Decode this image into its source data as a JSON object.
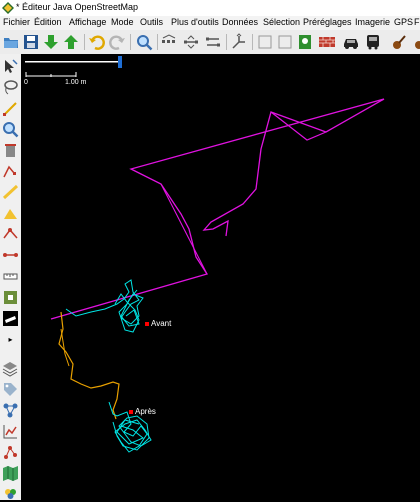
{
  "window": {
    "title": "* Éditeur Java OpenStreetMap"
  },
  "menu": [
    "Fichier",
    "Édition",
    "Affichage",
    "Mode",
    "Outils",
    "Plus d'outils",
    "Données",
    "Sélection",
    "Préréglages",
    "Imagerie",
    "GPS",
    "F"
  ],
  "map": {
    "scale_start": "0",
    "scale_end": "1.00 m",
    "markers": [
      {
        "label": "Avant"
      },
      {
        "label": "Après"
      }
    ]
  },
  "colors": {
    "way": "#e012e0",
    "gps_track": "#00e5e5",
    "old_track": "#e8a000",
    "marker": "#ff0000"
  },
  "icons": {
    "toolbar": [
      "open-folder-icon",
      "save-icon",
      "download-icon",
      "upload-icon",
      "undo-icon",
      "redo-icon",
      "zoom-icon",
      "select-nodes-icon",
      "align-icon",
      "move-icon",
      "split-icon",
      "preferences-icon",
      "wall-icon",
      "car-icon",
      "bus-icon",
      "guitar-icon"
    ],
    "left": [
      "select-tool-icon",
      "lasso-icon",
      "draw-tool-icon",
      "zoom-tool-icon",
      "delete-tool-icon",
      "parallel-tool-icon",
      "improve-way-icon",
      "extrude-icon",
      "draw-node-icon",
      "connect-icon",
      "measure-icon",
      "satellite-icon",
      "imagery-offset-icon",
      "layers-icon",
      "tag-icon",
      "relation-icon",
      "chart-icon",
      "relation-list-icon",
      "map-icon",
      "filter-icon",
      "changeset-icon",
      "notes-icon",
      "validator-icon"
    ]
  }
}
